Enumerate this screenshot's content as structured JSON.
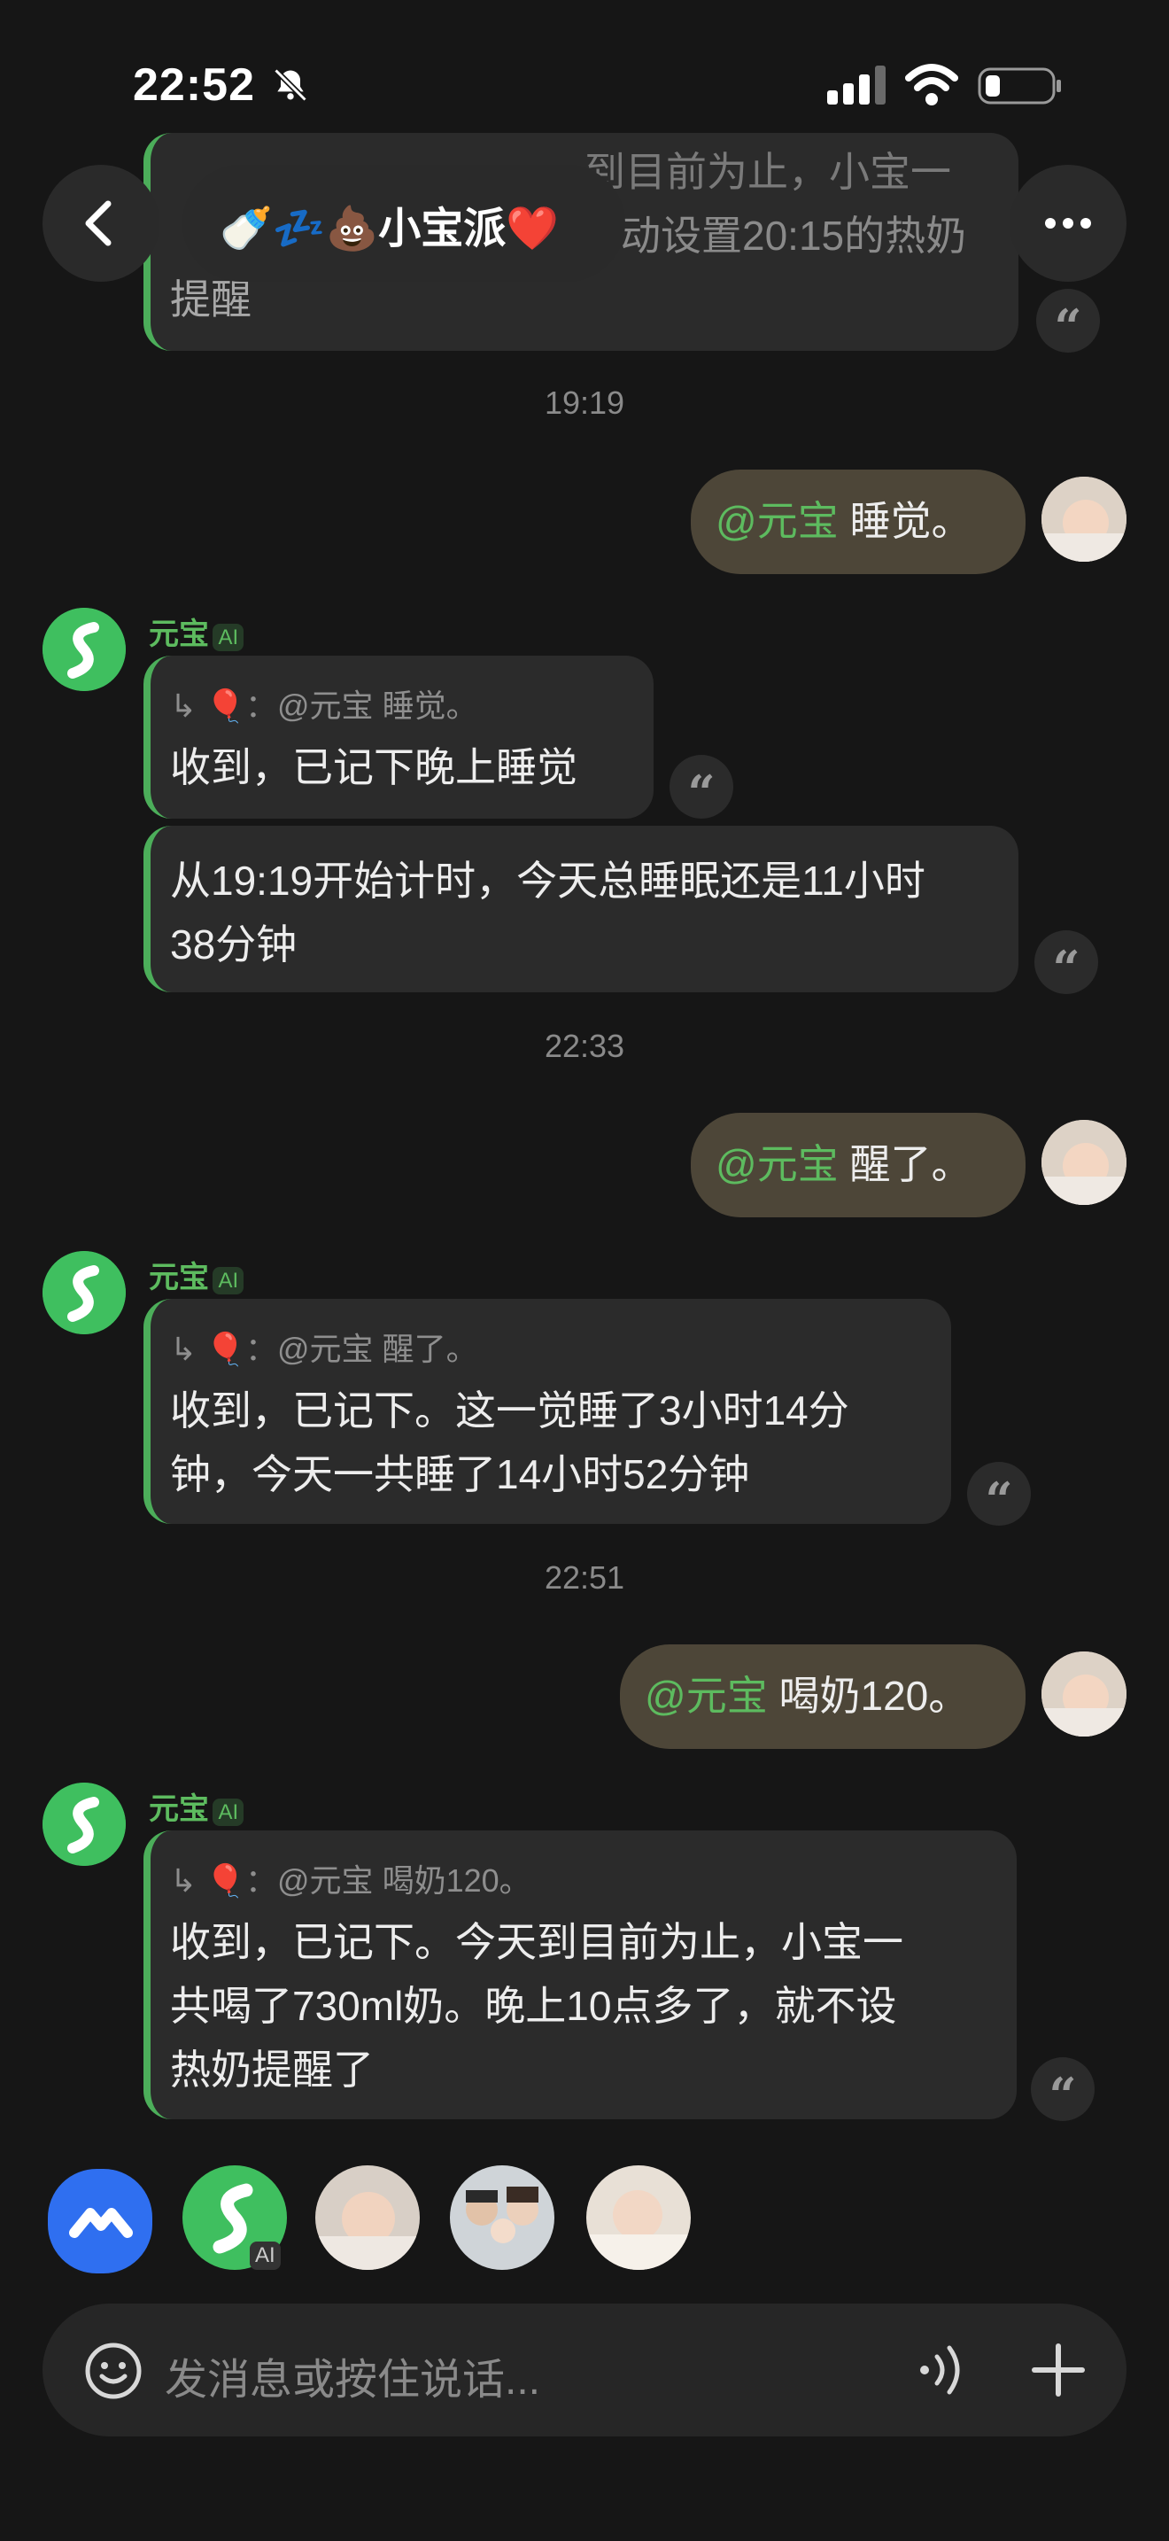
{
  "status_bar": {
    "time": "22:52"
  },
  "header": {
    "title": "🍼💤💩小宝派❤️"
  },
  "top_partial": {
    "lines": [
      "到目前为止，小宝一",
      "动设置20:15的热奶",
      "提醒"
    ]
  },
  "messages": [
    {
      "kind": "time",
      "text": "19:19"
    },
    {
      "kind": "user",
      "mention": "@元宝",
      "text": "睡觉。"
    },
    {
      "kind": "bot",
      "name": "元宝",
      "tag": "AI",
      "quote": "@元宝 睡觉。",
      "reply1": "收到，已记下晚上睡觉",
      "reply2_lines": [
        "从19:19开始计时，今天总睡眠还是11小时",
        "38分钟"
      ]
    },
    {
      "kind": "time",
      "text": "22:33"
    },
    {
      "kind": "user",
      "mention": "@元宝",
      "text": "醒了。"
    },
    {
      "kind": "bot",
      "name": "元宝",
      "tag": "AI",
      "quote": "@元宝 醒了。",
      "reply_lines": [
        "收到，已记下。这一觉睡了3小时14分",
        "钟，今天一共睡了14小时52分钟"
      ]
    },
    {
      "kind": "time",
      "text": "22:51"
    },
    {
      "kind": "user",
      "mention": "@元宝",
      "text": "喝奶120。"
    },
    {
      "kind": "bot",
      "name": "元宝",
      "tag": "AI",
      "quote": "@元宝 喝奶120。",
      "reply_lines": [
        "收到，已记下。今天到目前为止，小宝一",
        "共喝了730ml奶。晚上10点多了，就不设",
        "热奶提醒了"
      ]
    }
  ],
  "member_bar": {
    "ai_tag": "AI"
  },
  "input": {
    "placeholder": "发消息或按住说话..."
  },
  "colors": {
    "accent": "#5dbb5f",
    "bubble_user": "#4d4638",
    "bubble_bot": "#2b2b2b",
    "background": "#161616"
  }
}
